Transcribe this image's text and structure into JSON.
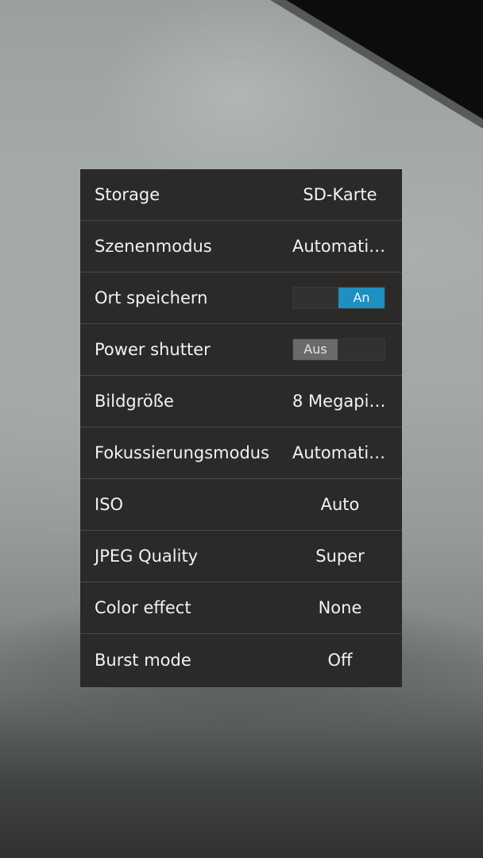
{
  "settings_panel": {
    "rows": [
      {
        "label": "Storage",
        "value": "SD-Karte"
      },
      {
        "label": "Szenenmodus",
        "value": "Automatis…"
      },
      {
        "label": "Ort speichern",
        "toggle": "An"
      },
      {
        "label": "Power shutter",
        "toggle": "Aus"
      },
      {
        "label": "Bildgröße",
        "value": "8 Megapix…"
      },
      {
        "label": "Fokussierungsmodus",
        "value": "Automatis…"
      },
      {
        "label": "ISO",
        "value": "Auto"
      },
      {
        "label": "JPEG Quality",
        "value": "Super"
      },
      {
        "label": "Color effect",
        "value": "None"
      },
      {
        "label": "Burst mode",
        "value": "Off"
      }
    ]
  },
  "colors": {
    "panel_background": "#2b2a29",
    "toggle_on": "#1f8fbf",
    "toggle_off": "#6b6a69",
    "divider": "#4a4948"
  }
}
